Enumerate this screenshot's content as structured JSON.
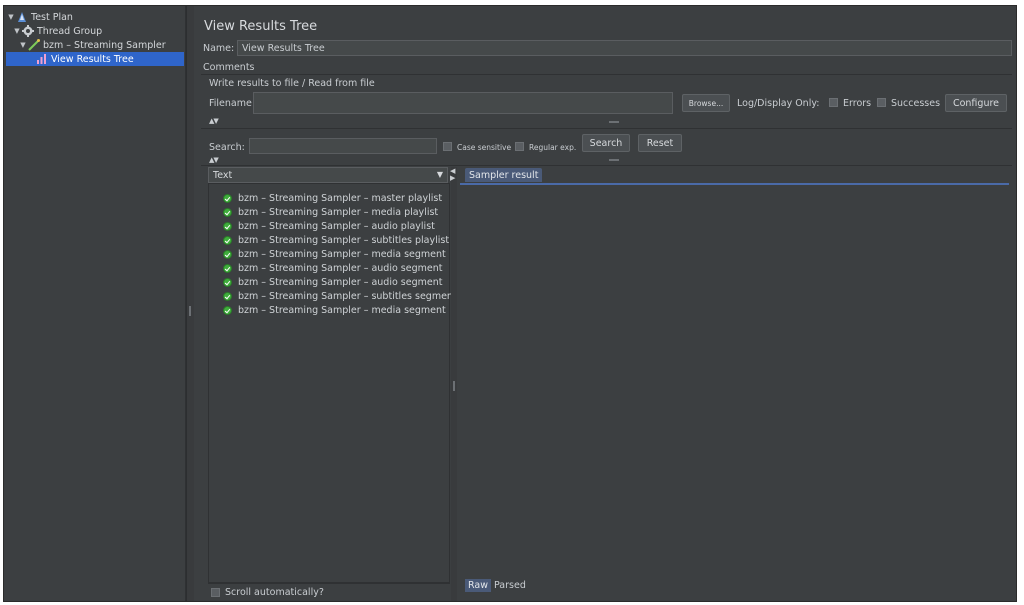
{
  "tree": {
    "items": [
      {
        "label": "Test Plan",
        "icon": "test-plan-icon",
        "arrow": "▼"
      },
      {
        "label": "Thread Group",
        "icon": "gear-icon",
        "arrow": "▼"
      },
      {
        "label": "bzm – Streaming Sampler",
        "icon": "sampler-icon",
        "arrow": "▼"
      },
      {
        "label": "View Results Tree",
        "icon": "listener-icon",
        "arrow": ""
      }
    ],
    "selected_index": 3
  },
  "panel": {
    "title": "View Results Tree",
    "name_label": "Name:",
    "name_value": "View Results Tree",
    "comments_label": "Comments",
    "write_results_label": "Write results to file / Read from file",
    "filename_label": "Filename",
    "filename_value": "",
    "browse_label": "Browse...",
    "log_display_label": "Log/Display Only:",
    "errors_label": "Errors",
    "successes_label": "Successes",
    "configure_label": "Configure"
  },
  "search": {
    "label": "Search:",
    "value": "",
    "case_sensitive_label": "Case sensitive",
    "regular_exp_label": "Regular exp.",
    "search_button": "Search",
    "reset_button": "Reset"
  },
  "renderer": {
    "selected": "Text"
  },
  "results": [
    "bzm – Streaming Sampler – master playlist",
    "bzm – Streaming Sampler – media playlist",
    "bzm – Streaming Sampler – audio playlist",
    "bzm – Streaming Sampler – subtitles playlist",
    "bzm – Streaming Sampler – media segment",
    "bzm – Streaming Sampler – audio segment",
    "bzm – Streaming Sampler – audio segment",
    "bzm – Streaming Sampler – subtitles segment",
    "bzm – Streaming Sampler – media segment"
  ],
  "scroll_auto_label": "Scroll automatically?",
  "result_tabs": {
    "sampler_result": "Sampler result",
    "raw": "Raw",
    "parsed": "Parsed"
  },
  "colors": {
    "background": "#3c3f41",
    "selection": "#2f65ca",
    "success": "#3fae3c"
  }
}
